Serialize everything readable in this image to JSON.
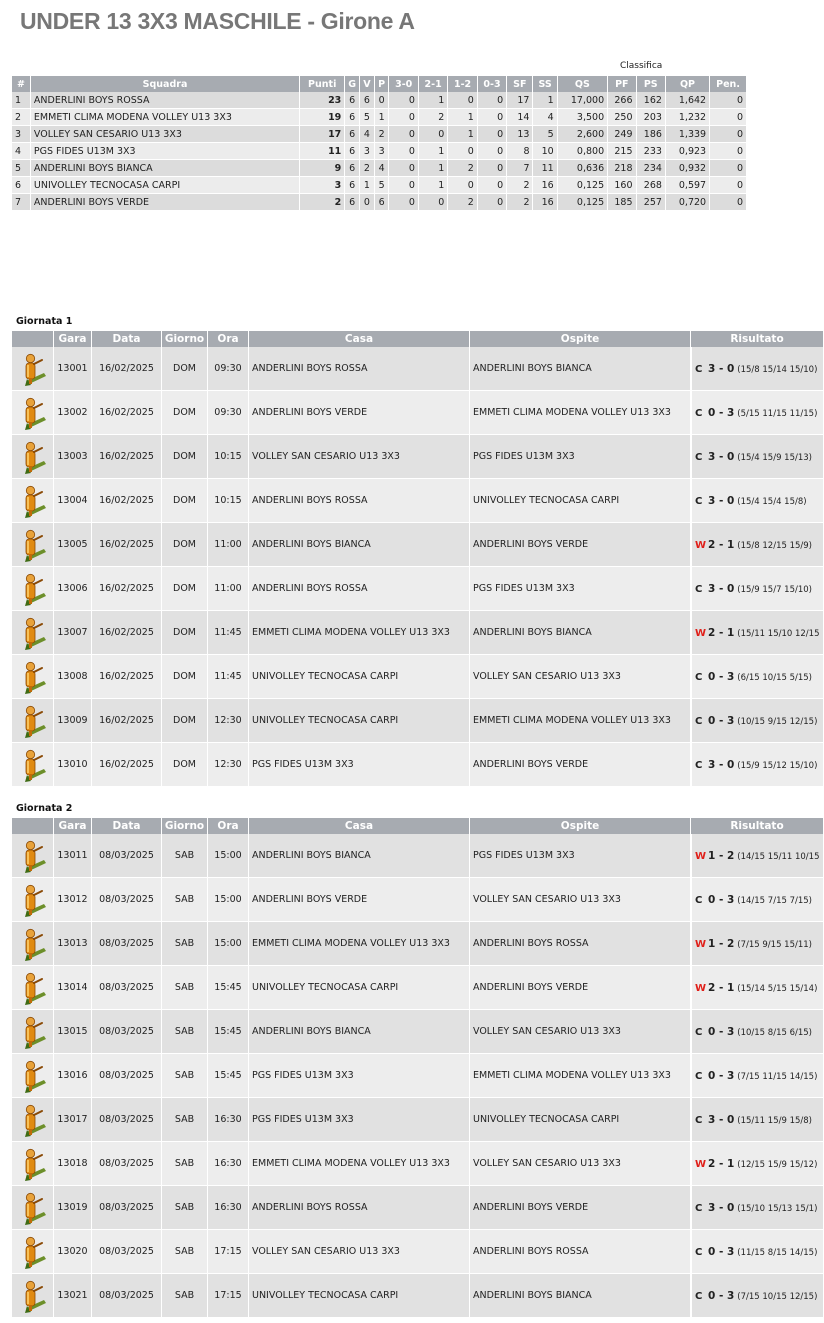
{
  "title": "UNDER 13 3X3 MASCHILE - Girone A",
  "standings": {
    "caption": "Classifica",
    "headers": [
      "#",
      "Squadra",
      "Punti",
      "G",
      "V",
      "P",
      "3-0",
      "2-1",
      "1-2",
      "0-3",
      "SF",
      "SS",
      "QS",
      "PF",
      "PS",
      "QP",
      "Pen."
    ],
    "rows": [
      [
        "1",
        "ANDERLINI BOYS ROSSA",
        "23",
        "6",
        "6",
        "0",
        "0",
        "1",
        "0",
        "0",
        "17",
        "1",
        "17,000",
        "266",
        "162",
        "1,642",
        "0"
      ],
      [
        "2",
        "EMMETI CLIMA MODENA VOLLEY U13 3X3",
        "19",
        "6",
        "5",
        "1",
        "0",
        "2",
        "1",
        "0",
        "14",
        "4",
        "3,500",
        "250",
        "203",
        "1,232",
        "0"
      ],
      [
        "3",
        "VOLLEY SAN CESARIO U13 3X3",
        "17",
        "6",
        "4",
        "2",
        "0",
        "0",
        "1",
        "0",
        "13",
        "5",
        "2,600",
        "249",
        "186",
        "1,339",
        "0"
      ],
      [
        "4",
        "PGS FIDES U13M 3X3",
        "11",
        "6",
        "3",
        "3",
        "0",
        "1",
        "0",
        "0",
        "8",
        "10",
        "0,800",
        "215",
        "233",
        "0,923",
        "0"
      ],
      [
        "5",
        "ANDERLINI BOYS BIANCA",
        "9",
        "6",
        "2",
        "4",
        "0",
        "1",
        "2",
        "0",
        "7",
        "11",
        "0,636",
        "218",
        "234",
        "0,932",
        "0"
      ],
      [
        "6",
        "UNIVOLLEY TECNOCASA CARPI",
        "3",
        "6",
        "1",
        "5",
        "0",
        "1",
        "0",
        "0",
        "2",
        "16",
        "0,125",
        "160",
        "268",
        "0,597",
        "0"
      ],
      [
        "7",
        "ANDERLINI BOYS VERDE",
        "2",
        "6",
        "0",
        "6",
        "0",
        "0",
        "2",
        "0",
        "2",
        "16",
        "0,125",
        "185",
        "257",
        "0,720",
        "0"
      ]
    ]
  },
  "match_headers": [
    "",
    "Gara",
    "Data",
    "Giorno",
    "Ora",
    "Casa",
    "Ospite",
    "Risultato"
  ],
  "rounds": [
    {
      "title": "Giornata 1",
      "matches": [
        {
          "gara": "13001",
          "data": "16/02/2025",
          "giorno": "DOM",
          "ora": "09:30",
          "casa": "ANDERLINI BOYS ROSSA",
          "ospite": "ANDERLINI BOYS BIANCA",
          "flag": "C",
          "score": "3 - 0",
          "sets": "(15/8 15/14 15/10)"
        },
        {
          "gara": "13002",
          "data": "16/02/2025",
          "giorno": "DOM",
          "ora": "09:30",
          "casa": "ANDERLINI BOYS VERDE",
          "ospite": "EMMETI CLIMA MODENA VOLLEY U13 3X3",
          "flag": "C",
          "score": "0 - 3",
          "sets": "(5/15 11/15 11/15)"
        },
        {
          "gara": "13003",
          "data": "16/02/2025",
          "giorno": "DOM",
          "ora": "10:15",
          "casa": "VOLLEY SAN CESARIO U13 3X3",
          "ospite": "PGS FIDES U13M 3X3",
          "flag": "C",
          "score": "3 - 0",
          "sets": "(15/4 15/9 15/13)"
        },
        {
          "gara": "13004",
          "data": "16/02/2025",
          "giorno": "DOM",
          "ora": "10:15",
          "casa": "ANDERLINI BOYS ROSSA",
          "ospite": "UNIVOLLEY TECNOCASA CARPI",
          "flag": "C",
          "score": "3 - 0",
          "sets": "(15/4 15/4 15/8)"
        },
        {
          "gara": "13005",
          "data": "16/02/2025",
          "giorno": "DOM",
          "ora": "11:00",
          "casa": "ANDERLINI BOYS BIANCA",
          "ospite": "ANDERLINI BOYS VERDE",
          "flag": "W",
          "score": "2 - 1",
          "sets": "(15/8 12/15 15/9)"
        },
        {
          "gara": "13006",
          "data": "16/02/2025",
          "giorno": "DOM",
          "ora": "11:00",
          "casa": "ANDERLINI BOYS ROSSA",
          "ospite": "PGS FIDES U13M 3X3",
          "flag": "C",
          "score": "3 - 0",
          "sets": "(15/9 15/7 15/10)"
        },
        {
          "gara": "13007",
          "data": "16/02/2025",
          "giorno": "DOM",
          "ora": "11:45",
          "casa": "EMMETI CLIMA MODENA VOLLEY U13 3X3",
          "ospite": "ANDERLINI BOYS BIANCA",
          "flag": "W",
          "score": "2 - 1",
          "sets": "(15/11 15/10 12/15"
        },
        {
          "gara": "13008",
          "data": "16/02/2025",
          "giorno": "DOM",
          "ora": "11:45",
          "casa": "UNIVOLLEY TECNOCASA CARPI",
          "ospite": "VOLLEY SAN CESARIO U13 3X3",
          "flag": "C",
          "score": "0 - 3",
          "sets": "(6/15 10/15 5/15)"
        },
        {
          "gara": "13009",
          "data": "16/02/2025",
          "giorno": "DOM",
          "ora": "12:30",
          "casa": "UNIVOLLEY TECNOCASA CARPI",
          "ospite": "EMMETI CLIMA MODENA VOLLEY U13 3X3",
          "flag": "C",
          "score": "0 - 3",
          "sets": "(10/15 9/15 12/15)"
        },
        {
          "gara": "13010",
          "data": "16/02/2025",
          "giorno": "DOM",
          "ora": "12:30",
          "casa": "PGS FIDES U13M 3X3",
          "ospite": "ANDERLINI BOYS VERDE",
          "flag": "C",
          "score": "3 - 0",
          "sets": "(15/9 15/12 15/10)"
        }
      ]
    },
    {
      "title": "Giornata 2",
      "matches": [
        {
          "gara": "13011",
          "data": "08/03/2025",
          "giorno": "SAB",
          "ora": "15:00",
          "casa": "ANDERLINI BOYS BIANCA",
          "ospite": "PGS FIDES U13M 3X3",
          "flag": "W",
          "score": "1 - 2",
          "sets": "(14/15 15/11 10/15"
        },
        {
          "gara": "13012",
          "data": "08/03/2025",
          "giorno": "SAB",
          "ora": "15:00",
          "casa": "ANDERLINI BOYS VERDE",
          "ospite": "VOLLEY SAN CESARIO U13 3X3",
          "flag": "C",
          "score": "0 - 3",
          "sets": "(14/15 7/15 7/15)"
        },
        {
          "gara": "13013",
          "data": "08/03/2025",
          "giorno": "SAB",
          "ora": "15:00",
          "casa": "EMMETI CLIMA MODENA VOLLEY U13 3X3",
          "ospite": "ANDERLINI BOYS ROSSA",
          "flag": "W",
          "score": "1 - 2",
          "sets": "(7/15 9/15 15/11)"
        },
        {
          "gara": "13014",
          "data": "08/03/2025",
          "giorno": "SAB",
          "ora": "15:45",
          "casa": "UNIVOLLEY TECNOCASA CARPI",
          "ospite": "ANDERLINI BOYS VERDE",
          "flag": "W",
          "score": "2 - 1",
          "sets": "(15/14 5/15 15/14)"
        },
        {
          "gara": "13015",
          "data": "08/03/2025",
          "giorno": "SAB",
          "ora": "15:45",
          "casa": "ANDERLINI BOYS BIANCA",
          "ospite": "VOLLEY SAN CESARIO U13 3X3",
          "flag": "C",
          "score": "0 - 3",
          "sets": "(10/15 8/15 6/15)"
        },
        {
          "gara": "13016",
          "data": "08/03/2025",
          "giorno": "SAB",
          "ora": "15:45",
          "casa": "PGS FIDES U13M 3X3",
          "ospite": "EMMETI CLIMA MODENA VOLLEY U13 3X3",
          "flag": "C",
          "score": "0 - 3",
          "sets": "(7/15 11/15 14/15)"
        },
        {
          "gara": "13017",
          "data": "08/03/2025",
          "giorno": "SAB",
          "ora": "16:30",
          "casa": "PGS FIDES U13M 3X3",
          "ospite": "UNIVOLLEY TECNOCASA CARPI",
          "flag": "C",
          "score": "3 - 0",
          "sets": "(15/11 15/9 15/8)"
        },
        {
          "gara": "13018",
          "data": "08/03/2025",
          "giorno": "SAB",
          "ora": "16:30",
          "casa": "EMMETI CLIMA MODENA VOLLEY U13 3X3",
          "ospite": "VOLLEY SAN CESARIO U13 3X3",
          "flag": "W",
          "score": "2 - 1",
          "sets": "(12/15 15/9 15/12)"
        },
        {
          "gara": "13019",
          "data": "08/03/2025",
          "giorno": "SAB",
          "ora": "16:30",
          "casa": "ANDERLINI BOYS ROSSA",
          "ospite": "ANDERLINI BOYS VERDE",
          "flag": "C",
          "score": "3 - 0",
          "sets": "(15/10 15/13 15/1)"
        },
        {
          "gara": "13020",
          "data": "08/03/2025",
          "giorno": "SAB",
          "ora": "17:15",
          "casa": "VOLLEY SAN CESARIO U13 3X3",
          "ospite": "ANDERLINI BOYS ROSSA",
          "flag": "C",
          "score": "0 - 3",
          "sets": "(11/15 8/15 14/15)"
        },
        {
          "gara": "13021",
          "data": "08/03/2025",
          "giorno": "SAB",
          "ora": "17:15",
          "casa": "UNIVOLLEY TECNOCASA CARPI",
          "ospite": "ANDERLINI BOYS BIANCA",
          "flag": "C",
          "score": "0 - 3",
          "sets": "(7/15 10/15 12/15)"
        }
      ]
    }
  ],
  "icons": {
    "match_row": "referee-whistle-icon"
  },
  "colors": {
    "header_bg": "#a7abb1",
    "row_odd": "#dcdcdc",
    "row_even": "#ececec",
    "win_flag": "#e0201a",
    "title": "#777777"
  }
}
